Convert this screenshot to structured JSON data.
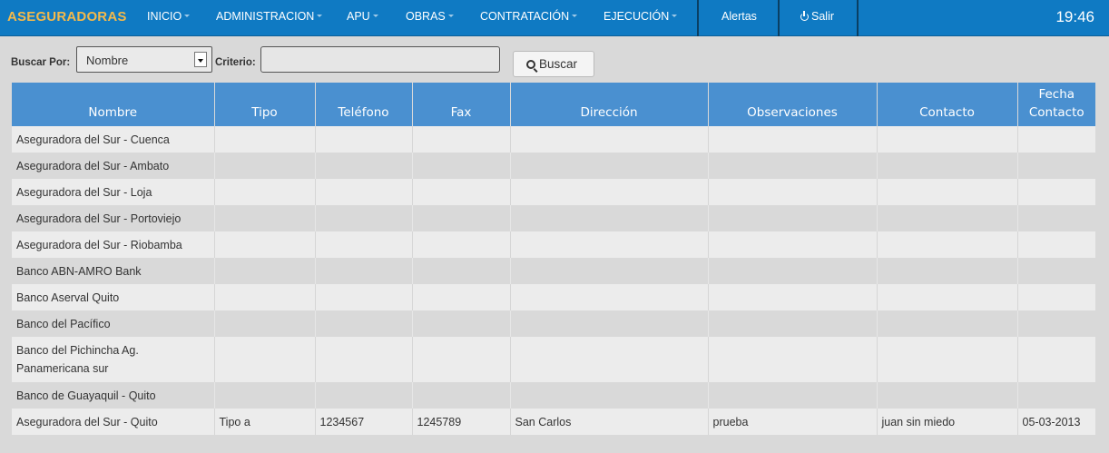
{
  "navbar": {
    "brand": "ASEGURADORAS",
    "menu": [
      {
        "label": "INICIO"
      },
      {
        "label": "ADMINISTRACION"
      },
      {
        "label": "APU"
      },
      {
        "label": "OBRAS"
      },
      {
        "label": "CONTRATACIÓN"
      },
      {
        "label": "EJECUCIÓN"
      }
    ],
    "alertas": "Alertas",
    "salir": "Salir",
    "clock": "19:46"
  },
  "search": {
    "buscar_por_label": "Buscar Por:",
    "buscar_por_value": "Nombre",
    "criterio_label": "Criterio:",
    "criterio_value": "",
    "button_label": "Buscar"
  },
  "table": {
    "columns": [
      "Nombre",
      "Tipo",
      "Teléfono",
      "Fax",
      "Dirección",
      "Observaciones",
      "Contacto",
      "Fecha Contacto"
    ],
    "rows": [
      [
        "Aseguradora del Sur - Cuenca",
        "",
        "",
        "",
        "",
        "",
        "",
        ""
      ],
      [
        "Aseguradora del Sur - Ambato",
        "",
        "",
        "",
        "",
        "",
        "",
        ""
      ],
      [
        "Aseguradora del Sur - Loja",
        "",
        "",
        "",
        "",
        "",
        "",
        ""
      ],
      [
        "Aseguradora del Sur - Portoviejo",
        "",
        "",
        "",
        "",
        "",
        "",
        ""
      ],
      [
        "Aseguradora del Sur - Riobamba",
        "",
        "",
        "",
        "",
        "",
        "",
        ""
      ],
      [
        "Banco ABN-AMRO Bank",
        "",
        "",
        "",
        "",
        "",
        "",
        ""
      ],
      [
        "Banco Aserval Quito",
        "",
        "",
        "",
        "",
        "",
        "",
        ""
      ],
      [
        "Banco del Pacífico",
        "",
        "",
        "",
        "",
        "",
        "",
        ""
      ],
      [
        "Banco del Pichincha Ag. Panamericana sur",
        "",
        "",
        "",
        "",
        "",
        "",
        ""
      ],
      [
        "Banco de Guayaquil - Quito",
        "",
        "",
        "",
        "",
        "",
        "",
        ""
      ],
      [
        "Aseguradora del Sur - Quito",
        "Tipo a",
        "1234567",
        "1245789",
        "San Carlos",
        "prueba",
        "juan sin miedo",
        "05-03-2013"
      ]
    ]
  }
}
